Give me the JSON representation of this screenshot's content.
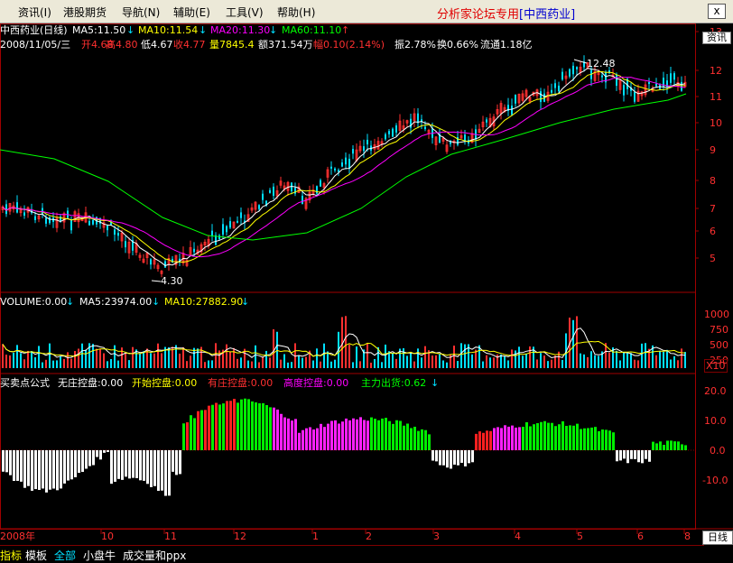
{
  "menu": {
    "items": [
      {
        "label": "资讯(I)"
      },
      {
        "label": "港股期货"
      },
      {
        "label": "导航(N)"
      },
      {
        "label": "辅助(E)"
      },
      {
        "label": "工具(V)"
      },
      {
        "label": "帮助(H)"
      }
    ],
    "title_main": "分析家论坛专用",
    "title_stock": "[中西药业]",
    "close_label": "x",
    "side_button": "资讯"
  },
  "price_panel": {
    "ma_header": {
      "name": "中西药业(日线)",
      "ma5": "MA5:11.50",
      "ma10": "MA10:11.54",
      "ma20": "MA20:11.30",
      "ma60": "MA60:11.10"
    },
    "info_line": {
      "date": "2008/11/05/三",
      "open": "开4.68",
      "high": "高4.80",
      "low": "低4.67",
      "close": "收4.77",
      "volume": "量7845.4",
      "amount": "额371.54万",
      "change": "幅0.10(2.14%)",
      "amplitude": "振2.78%",
      "turnover": "换0.66%",
      "float": "流通1.18亿"
    },
    "high_mark": "12.48",
    "low_mark": "4.30",
    "y_axis": [
      "13",
      "12",
      "11",
      "10",
      "9",
      "8",
      "7",
      "6",
      "5"
    ],
    "colors": {
      "up": "#ff3030",
      "down": "#00e0ff",
      "ma5": "#ffffff",
      "ma10": "#ffff00",
      "ma20": "#ff00ff",
      "ma60": "#00ff00"
    }
  },
  "volume_panel": {
    "label": "VOLUME:0.00",
    "ma5": "MA5:23974.00",
    "ma10": "MA10:27882.90",
    "y_axis": [
      "1000",
      "750",
      "500",
      "250"
    ],
    "unit": "X10"
  },
  "indicator_panel": {
    "name": "买卖点公式",
    "f1": "无庄控盘:0.00",
    "f2": "开始控盘:0.00",
    "f3": "有庄控盘:0.00",
    "f4": "高度控盘:0.00",
    "f5": "主力出货:0.62",
    "y_axis": [
      "20.0",
      "10.0",
      "0.0",
      "-10.0"
    ]
  },
  "time_axis": {
    "labels": [
      "2008年",
      "10",
      "11",
      "12",
      "1",
      "2",
      "3",
      "4",
      "5",
      "6",
      "8"
    ],
    "corner": "日线"
  },
  "bottom_tabs": [
    {
      "label": "指标"
    },
    {
      "label": "模板"
    },
    {
      "label": "全部"
    },
    {
      "label": "小盘牛"
    },
    {
      "label": "成交量和ppx"
    }
  ]
}
